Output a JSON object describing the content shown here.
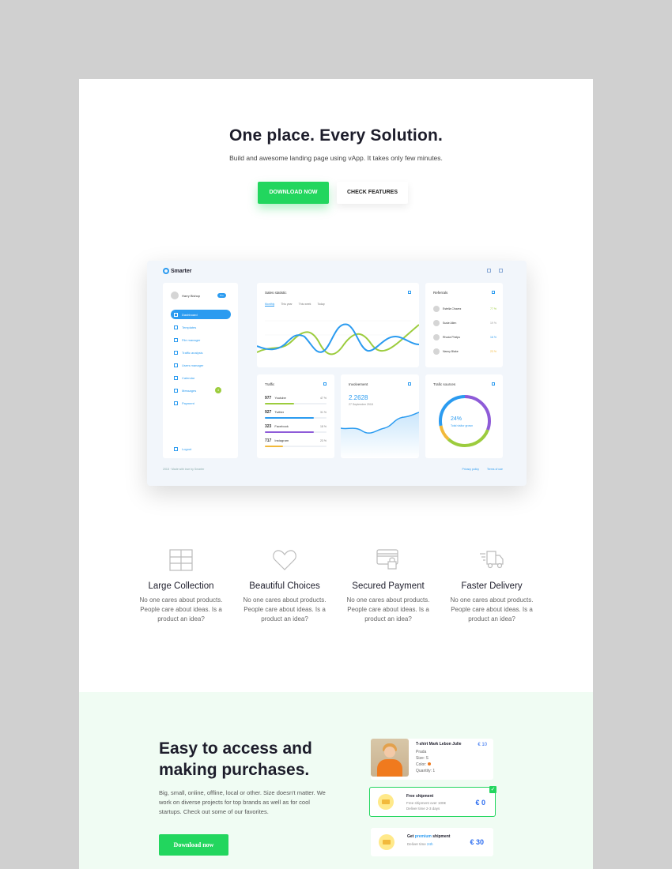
{
  "hero": {
    "title": "One place. Every Solution.",
    "subtitle": "Build and awesome landing page using vApp. It takes only few minutes.",
    "primary_button": "DOWNLOAD NOW",
    "secondary_button": "CHECK FEATURES"
  },
  "dashboard": {
    "logo": "Smarter",
    "user_name": "Harry Bishop",
    "user_badge": "Pro",
    "nav": [
      {
        "label": "Dashboard",
        "active": true
      },
      {
        "label": "Templates"
      },
      {
        "label": "File manager"
      },
      {
        "label": "Traffic analysis"
      },
      {
        "label": "Users manager"
      },
      {
        "label": "Calendar"
      },
      {
        "label": "Messages",
        "badge": "4"
      },
      {
        "label": "Payment"
      }
    ],
    "logout": "Logout",
    "sales_title": "Sales statistic",
    "sales_tabs": [
      "Monthly",
      "This year",
      "This week",
      "Today"
    ],
    "referrals_title": "Referrals",
    "referrals": [
      {
        "name": "Estella Chavez",
        "pct": "77 %",
        "color": "#9ccc3d"
      },
      {
        "name": "Susie Allen",
        "pct": "19 %",
        "color": "#999999"
      },
      {
        "name": "Rhoda Phelps",
        "pct": "16 %",
        "color": "#2b9bf0"
      },
      {
        "name": "Nancy Blake",
        "pct": "23 %",
        "color": "#f2b93b"
      }
    ],
    "traffic_title": "Traffic",
    "traffic": [
      {
        "num": "977",
        "src": "Youtube",
        "pct": "47 %",
        "level": 0.47,
        "color": "#9ccc3d"
      },
      {
        "num": "927",
        "src": "Twitter",
        "pct": "31 %",
        "level": 0.8,
        "color": "#2b9bf0"
      },
      {
        "num": "323",
        "src": "Facebook",
        "pct": "18 %",
        "level": 0.8,
        "color": "#8e5bd8"
      },
      {
        "num": "717",
        "src": "Instagram",
        "pct": "23 %",
        "level": 0.3,
        "color": "#f2b93b"
      }
    ],
    "involvement_title": "Involvement",
    "involvement_value": "2.2628",
    "involvement_date": "27 September 2018",
    "sources_title": "Trafic sources",
    "sources_value": "24%",
    "sources_label": "Total visitor grown",
    "footer_left": "2018 · Made with love by Smarter",
    "footer_links": [
      "Privacy policy",
      "Terms of use"
    ]
  },
  "features": [
    {
      "icon": "grid-icon",
      "title": "Large Collection",
      "text": "No one cares about products. People care about ideas. Is a product an idea?"
    },
    {
      "icon": "heart-icon",
      "title": "Beautiful Choices",
      "text": "No one cares about products. People care about ideas. Is a product an idea?"
    },
    {
      "icon": "card-lock-icon",
      "title": "Secured Payment",
      "text": "No one cares about products. People care about ideas. Is a product an idea?"
    },
    {
      "icon": "truck-icon",
      "title": "Faster Delivery",
      "text": "No one cares about products. People care about ideas. Is a product an idea?"
    }
  ],
  "purchase": {
    "title": "Easy to access and making purchases.",
    "text": "Big, small, online, offline, local or other. Size doesn't matter. We work on diverse projects for top brands as well as for cool startups. Check out some of our favorites.",
    "button": "Download now",
    "product": {
      "name": "T-shirt Mark Lebon Julie",
      "price": "€ 10",
      "brand": "Prada",
      "size": "Size: S",
      "color_label": "Color:",
      "quantity": "Quantity: 1"
    },
    "free_ship": {
      "title": "Free shipment",
      "line1": "Free shipment over 100€",
      "line2": "Deliver time 2-3 days",
      "price": "€ 0"
    },
    "premium_ship": {
      "title_a": "Get",
      "title_hl": "premium",
      "title_b": "shipment",
      "line_a": "Deliver time",
      "line_hl": "24h",
      "price": "€ 30"
    }
  },
  "colors": {
    "accent_green": "#22d65e",
    "accent_blue": "#2b9bf0",
    "chart_green": "#9ccc3d"
  }
}
